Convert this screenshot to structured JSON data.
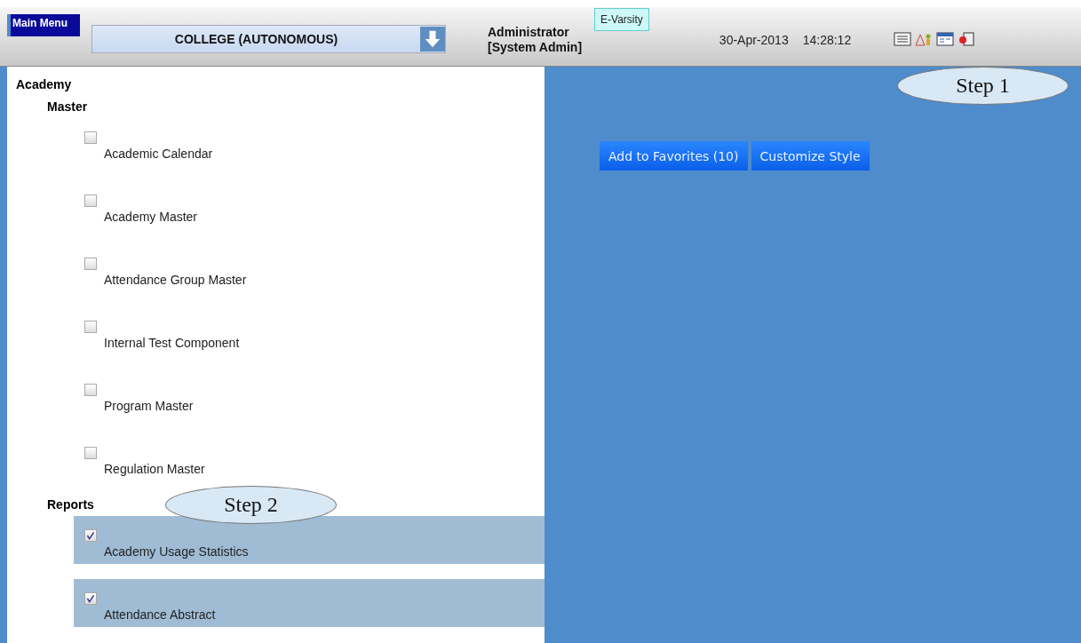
{
  "header": {
    "main_menu": "Main Menu",
    "institution": "COLLEGE (AUTONOMOUS)",
    "user": "Administrator",
    "role": "[System Admin]",
    "app_badge": "E-Varsity",
    "date": "30-Apr-2013",
    "time": "14:28:12",
    "callout": "Step 1"
  },
  "menu": {
    "title": "Academy",
    "sections": [
      {
        "title": "Master",
        "items": [
          {
            "label": "Academic Calendar",
            "checked": false
          },
          {
            "label": "Academy Master",
            "checked": false
          },
          {
            "label": "Attendance Group Master",
            "checked": false
          },
          {
            "label": "Internal Test Component",
            "checked": false
          },
          {
            "label": "Program Master",
            "checked": false
          },
          {
            "label": "Regulation Master",
            "checked": false
          }
        ]
      },
      {
        "title": "Reports",
        "callout": "Step 2",
        "items": [
          {
            "label": "Academy Usage Statistics",
            "checked": true
          },
          {
            "label": "Attendance Abstract",
            "checked": true
          }
        ]
      }
    ]
  },
  "actions": [
    "Add to Favorites (10)",
    "Customize Style"
  ]
}
